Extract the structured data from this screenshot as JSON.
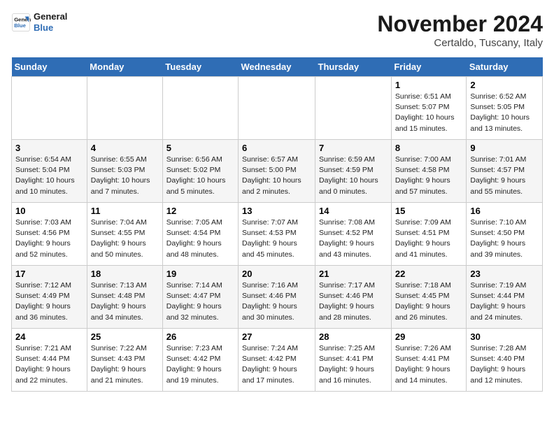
{
  "header": {
    "logo_line1": "General",
    "logo_line2": "Blue",
    "month_title": "November 2024",
    "location": "Certaldo, Tuscany, Italy"
  },
  "weekdays": [
    "Sunday",
    "Monday",
    "Tuesday",
    "Wednesday",
    "Thursday",
    "Friday",
    "Saturday"
  ],
  "weeks": [
    [
      {
        "day": "",
        "info": ""
      },
      {
        "day": "",
        "info": ""
      },
      {
        "day": "",
        "info": ""
      },
      {
        "day": "",
        "info": ""
      },
      {
        "day": "",
        "info": ""
      },
      {
        "day": "1",
        "info": "Sunrise: 6:51 AM\nSunset: 5:07 PM\nDaylight: 10 hours and 15 minutes."
      },
      {
        "day": "2",
        "info": "Sunrise: 6:52 AM\nSunset: 5:05 PM\nDaylight: 10 hours and 13 minutes."
      }
    ],
    [
      {
        "day": "3",
        "info": "Sunrise: 6:54 AM\nSunset: 5:04 PM\nDaylight: 10 hours and 10 minutes."
      },
      {
        "day": "4",
        "info": "Sunrise: 6:55 AM\nSunset: 5:03 PM\nDaylight: 10 hours and 7 minutes."
      },
      {
        "day": "5",
        "info": "Sunrise: 6:56 AM\nSunset: 5:02 PM\nDaylight: 10 hours and 5 minutes."
      },
      {
        "day": "6",
        "info": "Sunrise: 6:57 AM\nSunset: 5:00 PM\nDaylight: 10 hours and 2 minutes."
      },
      {
        "day": "7",
        "info": "Sunrise: 6:59 AM\nSunset: 4:59 PM\nDaylight: 10 hours and 0 minutes."
      },
      {
        "day": "8",
        "info": "Sunrise: 7:00 AM\nSunset: 4:58 PM\nDaylight: 9 hours and 57 minutes."
      },
      {
        "day": "9",
        "info": "Sunrise: 7:01 AM\nSunset: 4:57 PM\nDaylight: 9 hours and 55 minutes."
      }
    ],
    [
      {
        "day": "10",
        "info": "Sunrise: 7:03 AM\nSunset: 4:56 PM\nDaylight: 9 hours and 52 minutes."
      },
      {
        "day": "11",
        "info": "Sunrise: 7:04 AM\nSunset: 4:55 PM\nDaylight: 9 hours and 50 minutes."
      },
      {
        "day": "12",
        "info": "Sunrise: 7:05 AM\nSunset: 4:54 PM\nDaylight: 9 hours and 48 minutes."
      },
      {
        "day": "13",
        "info": "Sunrise: 7:07 AM\nSunset: 4:53 PM\nDaylight: 9 hours and 45 minutes."
      },
      {
        "day": "14",
        "info": "Sunrise: 7:08 AM\nSunset: 4:52 PM\nDaylight: 9 hours and 43 minutes."
      },
      {
        "day": "15",
        "info": "Sunrise: 7:09 AM\nSunset: 4:51 PM\nDaylight: 9 hours and 41 minutes."
      },
      {
        "day": "16",
        "info": "Sunrise: 7:10 AM\nSunset: 4:50 PM\nDaylight: 9 hours and 39 minutes."
      }
    ],
    [
      {
        "day": "17",
        "info": "Sunrise: 7:12 AM\nSunset: 4:49 PM\nDaylight: 9 hours and 36 minutes."
      },
      {
        "day": "18",
        "info": "Sunrise: 7:13 AM\nSunset: 4:48 PM\nDaylight: 9 hours and 34 minutes."
      },
      {
        "day": "19",
        "info": "Sunrise: 7:14 AM\nSunset: 4:47 PM\nDaylight: 9 hours and 32 minutes."
      },
      {
        "day": "20",
        "info": "Sunrise: 7:16 AM\nSunset: 4:46 PM\nDaylight: 9 hours and 30 minutes."
      },
      {
        "day": "21",
        "info": "Sunrise: 7:17 AM\nSunset: 4:46 PM\nDaylight: 9 hours and 28 minutes."
      },
      {
        "day": "22",
        "info": "Sunrise: 7:18 AM\nSunset: 4:45 PM\nDaylight: 9 hours and 26 minutes."
      },
      {
        "day": "23",
        "info": "Sunrise: 7:19 AM\nSunset: 4:44 PM\nDaylight: 9 hours and 24 minutes."
      }
    ],
    [
      {
        "day": "24",
        "info": "Sunrise: 7:21 AM\nSunset: 4:44 PM\nDaylight: 9 hours and 22 minutes."
      },
      {
        "day": "25",
        "info": "Sunrise: 7:22 AM\nSunset: 4:43 PM\nDaylight: 9 hours and 21 minutes."
      },
      {
        "day": "26",
        "info": "Sunrise: 7:23 AM\nSunset: 4:42 PM\nDaylight: 9 hours and 19 minutes."
      },
      {
        "day": "27",
        "info": "Sunrise: 7:24 AM\nSunset: 4:42 PM\nDaylight: 9 hours and 17 minutes."
      },
      {
        "day": "28",
        "info": "Sunrise: 7:25 AM\nSunset: 4:41 PM\nDaylight: 9 hours and 16 minutes."
      },
      {
        "day": "29",
        "info": "Sunrise: 7:26 AM\nSunset: 4:41 PM\nDaylight: 9 hours and 14 minutes."
      },
      {
        "day": "30",
        "info": "Sunrise: 7:28 AM\nSunset: 4:40 PM\nDaylight: 9 hours and 12 minutes."
      }
    ]
  ]
}
